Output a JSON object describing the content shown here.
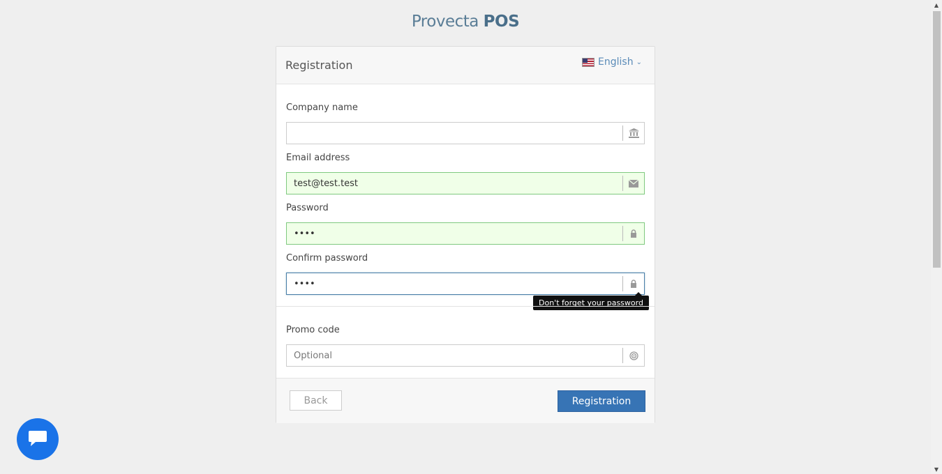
{
  "brand": {
    "light": "Provecta",
    "bold": "POS"
  },
  "panel": {
    "title": "Registration",
    "language": "English"
  },
  "fields": {
    "company": {
      "label": "Company name",
      "value": "",
      "placeholder": ""
    },
    "email": {
      "label": "Email address",
      "value": "test@test.test",
      "placeholder": ""
    },
    "password": {
      "label": "Password",
      "value": "••••"
    },
    "confirm": {
      "label": "Confirm password",
      "value": "••••"
    },
    "promo": {
      "label": "Promo code",
      "value": "",
      "placeholder": "Optional"
    }
  },
  "tooltip": "Don't forget your password",
  "buttons": {
    "back": "Back",
    "register": "Registration"
  },
  "icons": {
    "company": "bank-icon",
    "email": "envelope-icon",
    "password": "lock-icon",
    "confirm": "lock-icon",
    "promo": "target-icon",
    "chat": "chat-icon"
  },
  "colors": {
    "brand": "#4a6f8a",
    "primary": "#3774b5",
    "valid": "#f0ffe8",
    "chat": "#1a73e8"
  }
}
